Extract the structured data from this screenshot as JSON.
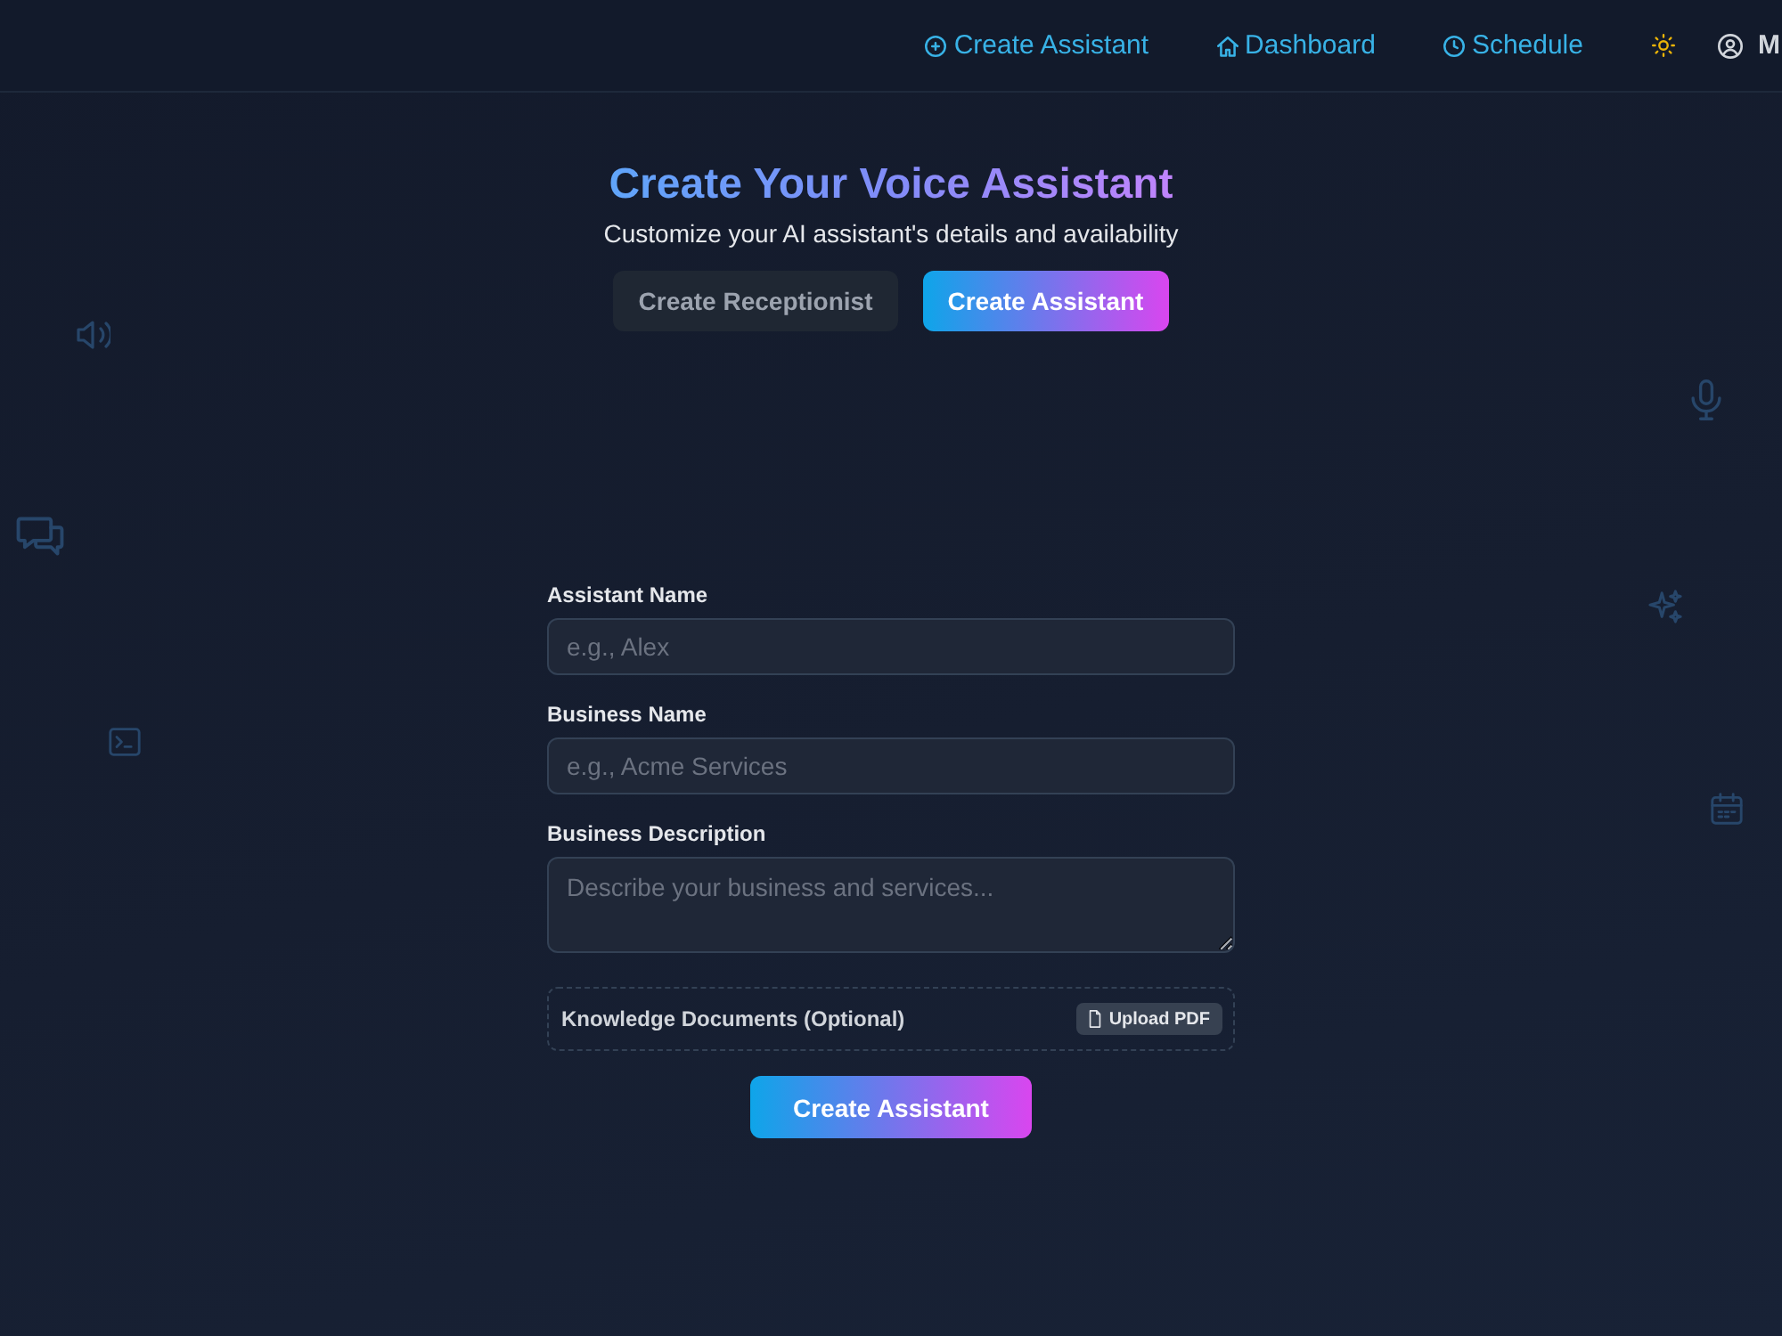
{
  "header": {
    "nav": [
      {
        "label": "Create Assistant"
      },
      {
        "label": "Dashboard"
      },
      {
        "label": "Schedule"
      }
    ],
    "user": {
      "label": "M"
    }
  },
  "hero": {
    "title": "Create Your Voice Assistant",
    "subtitle": "Customize your AI assistant's details and availability",
    "modes": [
      {
        "label": "Create Receptionist",
        "selected": false
      },
      {
        "label": "Create Assistant",
        "selected": true
      }
    ]
  },
  "form": {
    "fields": [
      {
        "kind": "input",
        "label": "Assistant Name",
        "placeholder": "e.g., Alex"
      },
      {
        "kind": "input",
        "label": "Business Name",
        "placeholder": "e.g., Acme Services"
      },
      {
        "kind": "textarea",
        "label": "Business Description",
        "placeholder": "Describe your business and services..."
      }
    ],
    "documents": {
      "label": "Knowledge Documents (Optional)",
      "button": "Upload PDF"
    },
    "submit": "Create Assistant"
  }
}
